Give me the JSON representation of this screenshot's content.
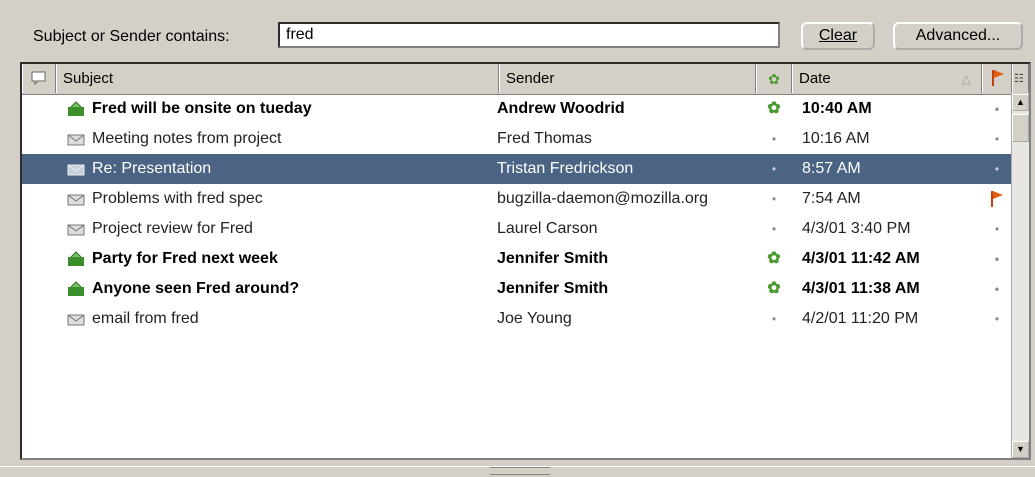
{
  "search": {
    "label": "Subject or Sender contains:",
    "value": "fred",
    "clear_label": "Clear",
    "advanced_label": "Advanced..."
  },
  "columns": {
    "subject": "Subject",
    "sender": "Sender",
    "date": "Date"
  },
  "colors": {
    "selection": "#4b6483",
    "flag": "#e06010",
    "unread_icon": "#3a8f2a",
    "status_green": "#4a9a30"
  },
  "messages": [
    {
      "subject": "Fred will be onsite on tueday",
      "sender": "Andrew Woodrid",
      "date": "10:40 AM",
      "unread": true,
      "flagged": false
    },
    {
      "subject": "Meeting notes from project",
      "sender": "Fred Thomas",
      "date": "10:16 AM",
      "unread": false,
      "flagged": false
    },
    {
      "subject": "Re: Presentation",
      "sender": "Tristan Fredrickson",
      "date": "8:57 AM",
      "unread": false,
      "flagged": false,
      "selected": true
    },
    {
      "subject": "Problems with fred spec",
      "sender": "bugzilla-daemon@mozilla.org",
      "date": "7:54 AM",
      "unread": false,
      "flagged": true
    },
    {
      "subject": "Project review for Fred",
      "sender": "Laurel Carson",
      "date": "4/3/01 3:40 PM",
      "unread": false,
      "flagged": false
    },
    {
      "subject": "Party for Fred next week",
      "sender": "Jennifer Smith",
      "date": "4/3/01 11:42 AM",
      "unread": true,
      "flagged": false
    },
    {
      "subject": "Anyone seen Fred around?",
      "sender": "Jennifer Smith",
      "date": "4/3/01 11:38 AM",
      "unread": true,
      "flagged": false
    },
    {
      "subject": "email from fred",
      "sender": "Joe Young",
      "date": "4/2/01 11:20 PM",
      "unread": false,
      "flagged": false
    }
  ]
}
